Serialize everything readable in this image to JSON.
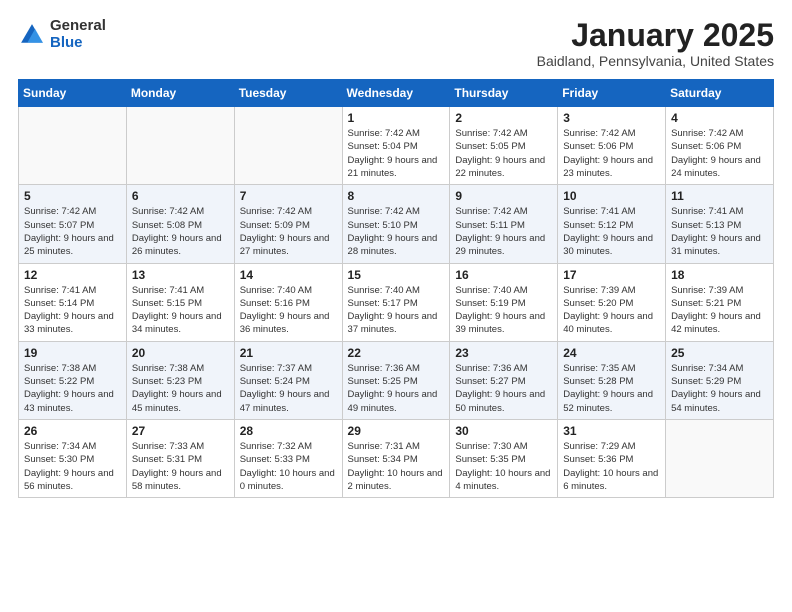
{
  "header": {
    "logo_general": "General",
    "logo_blue": "Blue",
    "month_title": "January 2025",
    "location": "Baidland, Pennsylvania, United States"
  },
  "weekdays": [
    "Sunday",
    "Monday",
    "Tuesday",
    "Wednesday",
    "Thursday",
    "Friday",
    "Saturday"
  ],
  "weeks": [
    [
      {
        "day": "",
        "info": ""
      },
      {
        "day": "",
        "info": ""
      },
      {
        "day": "",
        "info": ""
      },
      {
        "day": "1",
        "info": "Sunrise: 7:42 AM\nSunset: 5:04 PM\nDaylight: 9 hours and 21 minutes."
      },
      {
        "day": "2",
        "info": "Sunrise: 7:42 AM\nSunset: 5:05 PM\nDaylight: 9 hours and 22 minutes."
      },
      {
        "day": "3",
        "info": "Sunrise: 7:42 AM\nSunset: 5:06 PM\nDaylight: 9 hours and 23 minutes."
      },
      {
        "day": "4",
        "info": "Sunrise: 7:42 AM\nSunset: 5:06 PM\nDaylight: 9 hours and 24 minutes."
      }
    ],
    [
      {
        "day": "5",
        "info": "Sunrise: 7:42 AM\nSunset: 5:07 PM\nDaylight: 9 hours and 25 minutes."
      },
      {
        "day": "6",
        "info": "Sunrise: 7:42 AM\nSunset: 5:08 PM\nDaylight: 9 hours and 26 minutes."
      },
      {
        "day": "7",
        "info": "Sunrise: 7:42 AM\nSunset: 5:09 PM\nDaylight: 9 hours and 27 minutes."
      },
      {
        "day": "8",
        "info": "Sunrise: 7:42 AM\nSunset: 5:10 PM\nDaylight: 9 hours and 28 minutes."
      },
      {
        "day": "9",
        "info": "Sunrise: 7:42 AM\nSunset: 5:11 PM\nDaylight: 9 hours and 29 minutes."
      },
      {
        "day": "10",
        "info": "Sunrise: 7:41 AM\nSunset: 5:12 PM\nDaylight: 9 hours and 30 minutes."
      },
      {
        "day": "11",
        "info": "Sunrise: 7:41 AM\nSunset: 5:13 PM\nDaylight: 9 hours and 31 minutes."
      }
    ],
    [
      {
        "day": "12",
        "info": "Sunrise: 7:41 AM\nSunset: 5:14 PM\nDaylight: 9 hours and 33 minutes."
      },
      {
        "day": "13",
        "info": "Sunrise: 7:41 AM\nSunset: 5:15 PM\nDaylight: 9 hours and 34 minutes."
      },
      {
        "day": "14",
        "info": "Sunrise: 7:40 AM\nSunset: 5:16 PM\nDaylight: 9 hours and 36 minutes."
      },
      {
        "day": "15",
        "info": "Sunrise: 7:40 AM\nSunset: 5:17 PM\nDaylight: 9 hours and 37 minutes."
      },
      {
        "day": "16",
        "info": "Sunrise: 7:40 AM\nSunset: 5:19 PM\nDaylight: 9 hours and 39 minutes."
      },
      {
        "day": "17",
        "info": "Sunrise: 7:39 AM\nSunset: 5:20 PM\nDaylight: 9 hours and 40 minutes."
      },
      {
        "day": "18",
        "info": "Sunrise: 7:39 AM\nSunset: 5:21 PM\nDaylight: 9 hours and 42 minutes."
      }
    ],
    [
      {
        "day": "19",
        "info": "Sunrise: 7:38 AM\nSunset: 5:22 PM\nDaylight: 9 hours and 43 minutes."
      },
      {
        "day": "20",
        "info": "Sunrise: 7:38 AM\nSunset: 5:23 PM\nDaylight: 9 hours and 45 minutes."
      },
      {
        "day": "21",
        "info": "Sunrise: 7:37 AM\nSunset: 5:24 PM\nDaylight: 9 hours and 47 minutes."
      },
      {
        "day": "22",
        "info": "Sunrise: 7:36 AM\nSunset: 5:25 PM\nDaylight: 9 hours and 49 minutes."
      },
      {
        "day": "23",
        "info": "Sunrise: 7:36 AM\nSunset: 5:27 PM\nDaylight: 9 hours and 50 minutes."
      },
      {
        "day": "24",
        "info": "Sunrise: 7:35 AM\nSunset: 5:28 PM\nDaylight: 9 hours and 52 minutes."
      },
      {
        "day": "25",
        "info": "Sunrise: 7:34 AM\nSunset: 5:29 PM\nDaylight: 9 hours and 54 minutes."
      }
    ],
    [
      {
        "day": "26",
        "info": "Sunrise: 7:34 AM\nSunset: 5:30 PM\nDaylight: 9 hours and 56 minutes."
      },
      {
        "day": "27",
        "info": "Sunrise: 7:33 AM\nSunset: 5:31 PM\nDaylight: 9 hours and 58 minutes."
      },
      {
        "day": "28",
        "info": "Sunrise: 7:32 AM\nSunset: 5:33 PM\nDaylight: 10 hours and 0 minutes."
      },
      {
        "day": "29",
        "info": "Sunrise: 7:31 AM\nSunset: 5:34 PM\nDaylight: 10 hours and 2 minutes."
      },
      {
        "day": "30",
        "info": "Sunrise: 7:30 AM\nSunset: 5:35 PM\nDaylight: 10 hours and 4 minutes."
      },
      {
        "day": "31",
        "info": "Sunrise: 7:29 AM\nSunset: 5:36 PM\nDaylight: 10 hours and 6 minutes."
      },
      {
        "day": "",
        "info": ""
      }
    ]
  ]
}
